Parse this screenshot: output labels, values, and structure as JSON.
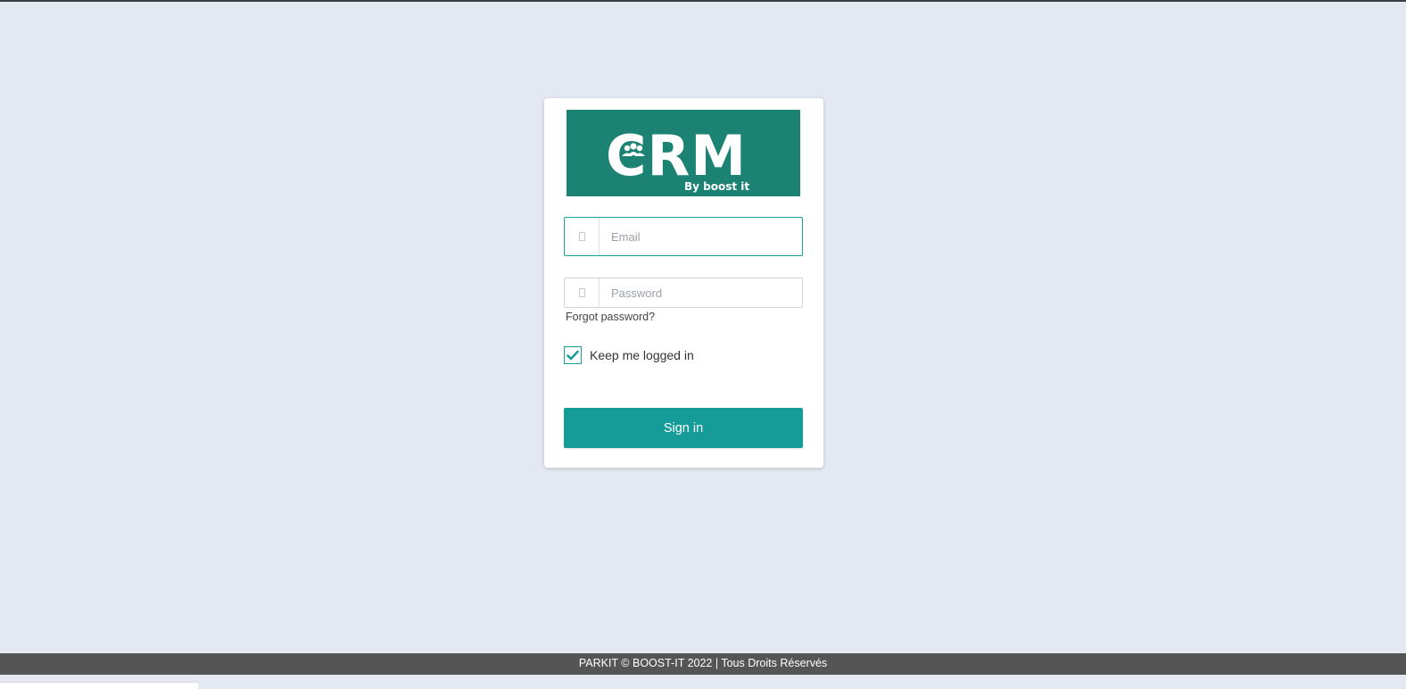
{
  "logo": {
    "main_text": "CRM",
    "tagline": "By boost it",
    "background": "#1b8274"
  },
  "login": {
    "email": {
      "placeholder": "Email",
      "value": "",
      "icon": "user-icon"
    },
    "password": {
      "placeholder": "Password",
      "value": "",
      "icon": "lock-icon"
    },
    "forgot_password": "Forgot password?",
    "remember_me": {
      "label": "Keep me logged in",
      "checked": true
    },
    "submit_label": "Sign in"
  },
  "footer": {
    "text": "PARKIT © BOOST-IT 2022 | Tous Droits Réservés"
  },
  "colors": {
    "accent": "#159c99",
    "page_background": "#e3e8f1",
    "footer_background": "#555555"
  }
}
